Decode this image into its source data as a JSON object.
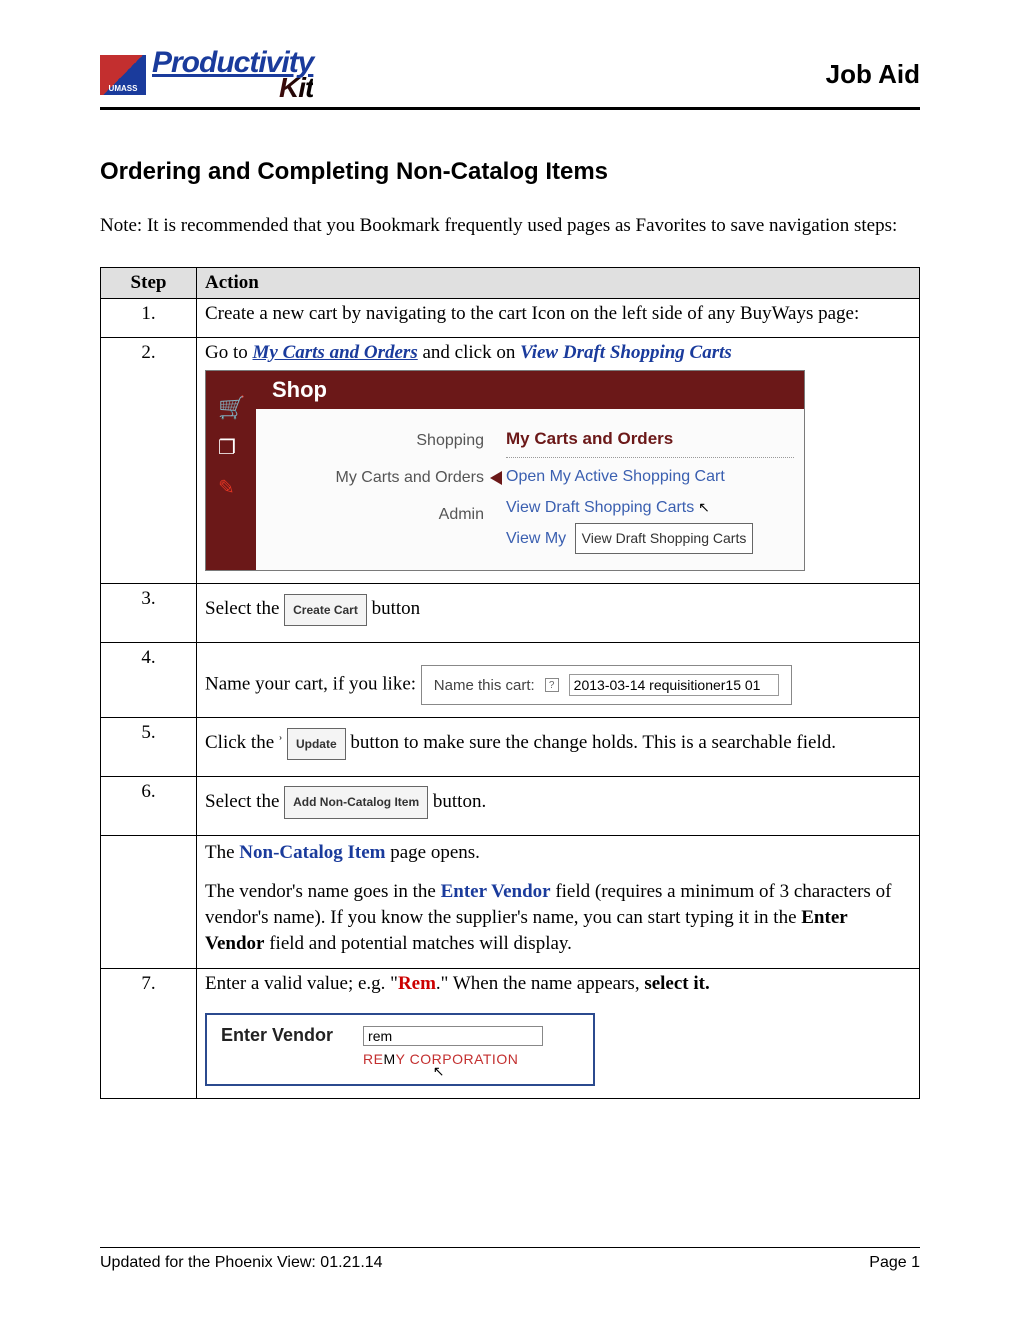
{
  "header": {
    "logo_small": "UMASS",
    "logo_top": "Productivity",
    "logo_bot": "Kit",
    "job_aid": "Job Aid"
  },
  "title": "Ordering and Completing Non-Catalog Items",
  "note": "Note:  It is recommended that you Bookmark frequently used pages as Favorites to save navigation steps:",
  "table": {
    "head_step": "Step",
    "head_action": "Action",
    "rows": {
      "r1": {
        "num": "1.",
        "text": "Create a new cart by navigating to the cart Icon  on the left side of any BuyWays page:"
      },
      "r2": {
        "num": "2.",
        "pre": "Go to  ",
        "link1": "My Carts and Orders",
        "mid": " and click on ",
        "link2": "View Draft Shopping Carts",
        "ui": {
          "shop": "Shop",
          "left_items": [
            "Shopping",
            "My Carts and Orders",
            "Admin"
          ],
          "right_header": "My Carts and Orders",
          "right_items": [
            "Open My Active Shopping Cart",
            "View Draft Shopping Carts"
          ],
          "view_my": "View My",
          "tooltip": "View Draft Shopping Carts"
        }
      },
      "r3": {
        "num": "3.",
        "pre": "Select the ",
        "btn": "Create Cart",
        "post": " button"
      },
      "r4": {
        "num": "4.",
        "text": "Name your cart, if you like:",
        "label": "Name this cart:",
        "value": "2013-03-14 requisitioner15 01"
      },
      "r5": {
        "num": "5.",
        "pre": "Click the",
        "btn": "Update",
        "post": " button to make sure the change holds.  This is a searchable field."
      },
      "r6": {
        "num": "6.",
        "pre": "Select the ",
        "btn": "Add Non-Catalog Item",
        "post": " button."
      },
      "r6b": {
        "l1a": "The ",
        "l1b": "Non-Catalog Item",
        "l1c": " page opens.",
        "l2a": "The vendor's name goes in the ",
        "l2b": "Enter Vendor",
        "l2c": " field (requires a minimum of 3 characters of vendor's name).  If you know the supplier's name, you can start typing it in the ",
        "l2d": "Enter Vendor",
        "l2e": " field and potential matches will display."
      },
      "r7": {
        "num": "7.",
        "pre": "Enter a valid value; e.g. \"",
        "mid": "Rem",
        "post1": ".\"  When the name appears, ",
        "post2": "select it.",
        "box_label": "Enter Vendor",
        "box_value": "rem",
        "suggest": "REMY CORPORATION"
      }
    }
  },
  "footer": {
    "left": "Updated for the Phoenix View: 01.21.14",
    "right": "Page 1"
  }
}
